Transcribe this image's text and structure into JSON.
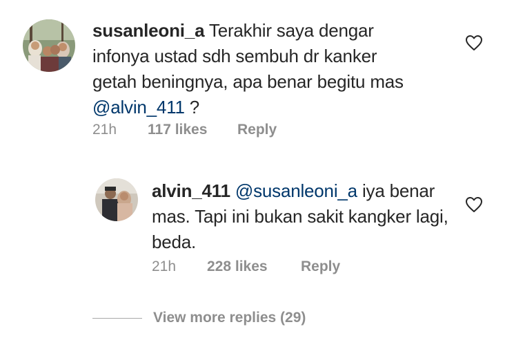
{
  "comment": {
    "username": "susanleoni_a",
    "text_before": "Terakhir saya dengar infonya ustad sdh sembuh dr kanker getah beningnya, apa benar begitu mas",
    "mention": "@alvin_411",
    "text_after": " ?",
    "time": "21h",
    "likes": "117 likes",
    "reply": "Reply",
    "avatar_icon": "family-photo-avatar",
    "like_icon": "heart-outline-icon"
  },
  "reply": {
    "username": "alvin_411",
    "mention": "@susanleoni_a",
    "text_after": " iya benar mas. Tapi ini bukan sakit kangker lagi, beda.",
    "time": "21h",
    "likes": "228 likes",
    "reply": "Reply",
    "avatar_icon": "couple-photo-avatar",
    "like_icon": "heart-outline-icon"
  },
  "view_more": {
    "label": "View more replies (29)"
  },
  "colors": {
    "text": "#262626",
    "mention": "#00376b",
    "meta": "#8e8e8e",
    "background": "#ffffff"
  }
}
